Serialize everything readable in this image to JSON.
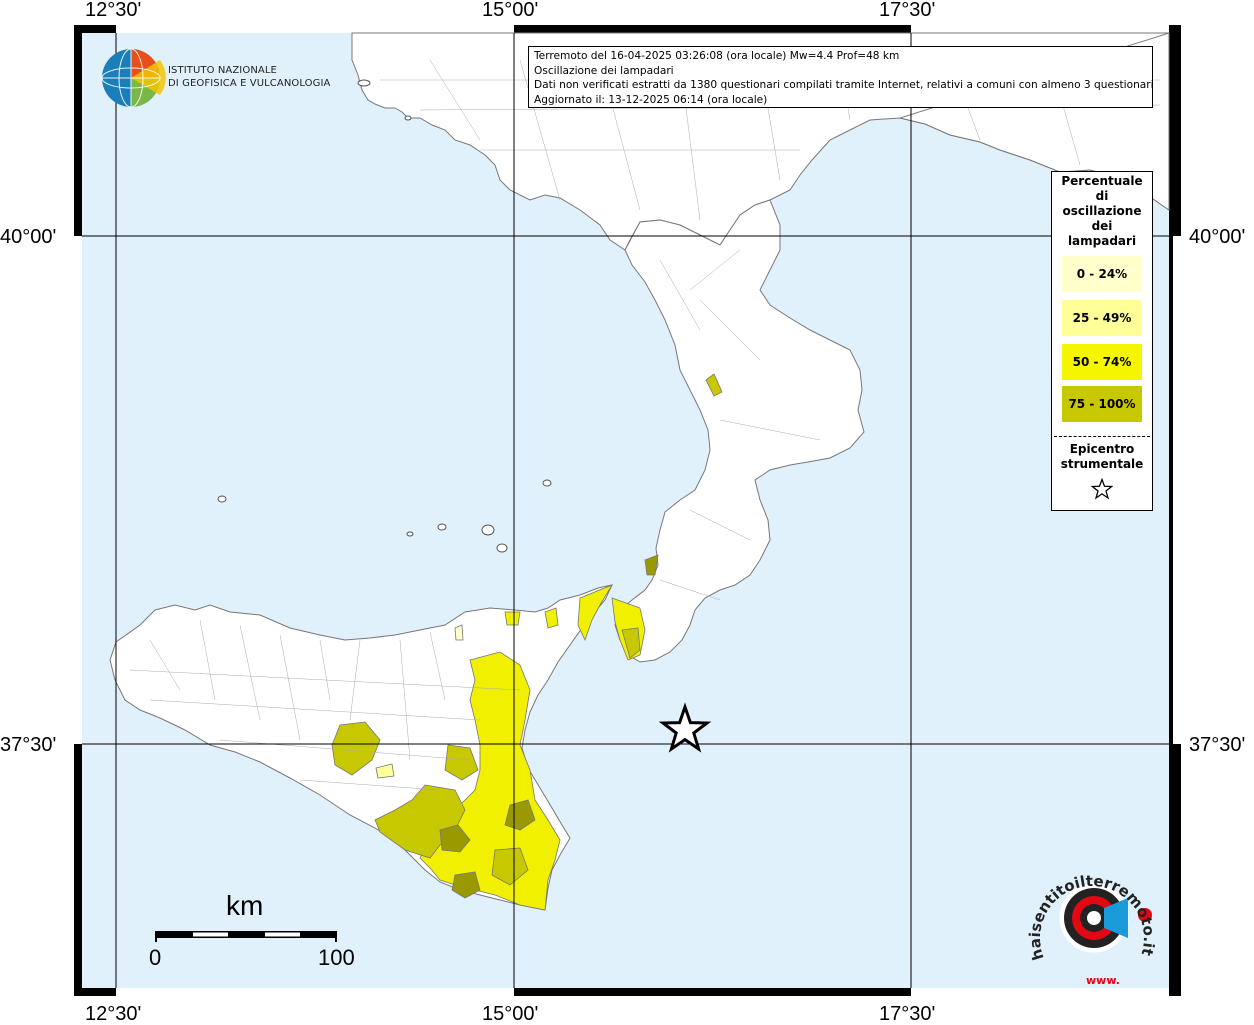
{
  "coordinates": {
    "top": [
      "12°30'",
      "15°00'",
      "17°30'"
    ],
    "bottom": [
      "12°30'",
      "15°00'",
      "17°30'"
    ],
    "left": [
      "40°00'",
      "37°30'"
    ],
    "right": [
      "40°00'",
      "37°30'"
    ]
  },
  "info": {
    "line1": "Terremoto del 16-04-2025 03:26:08 (ora locale) Mw=4.4 Prof=48 km",
    "line2": "Oscillazione dei lampadari",
    "line3": "Dati non verificati estratti da 1380 questionari compilati tramite Internet, relativi a comuni con almeno 3 questionari.",
    "line4": "Aggiornato il: 13-12-2025 06:14 (ora locale)"
  },
  "logo": {
    "line1": "ISTITUTO NAZIONALE",
    "line2": "DI GEOFISICA E VULCANOLOGIA"
  },
  "legend": {
    "title_lines": [
      "Percentuale",
      "di",
      "oscillazione",
      "dei",
      "lampadari"
    ],
    "items": [
      {
        "label": "0 - 24%",
        "color": "#ffffcc"
      },
      {
        "label": "25 - 49%",
        "color": "#ffff99"
      },
      {
        "label": "50 - 74%",
        "color": "#f5f500"
      },
      {
        "label": "75 - 100%",
        "color": "#c8c800"
      }
    ],
    "epicenter_lines": [
      "Epicentro",
      "strumentale"
    ]
  },
  "scale": {
    "unit": "km",
    "start": "0",
    "end": "100"
  },
  "hst_logo": {
    "text": "haisentitoilterremoto.it",
    "prefix": "www."
  },
  "colors": {
    "sea": "#e1f1fc",
    "land": "#ffffff",
    "grid": "#000000",
    "class1": "#ffffcc",
    "class2": "#ffff99",
    "class3": "#f0f000",
    "class4": "#c8c800",
    "class5": "#9a9a00"
  }
}
